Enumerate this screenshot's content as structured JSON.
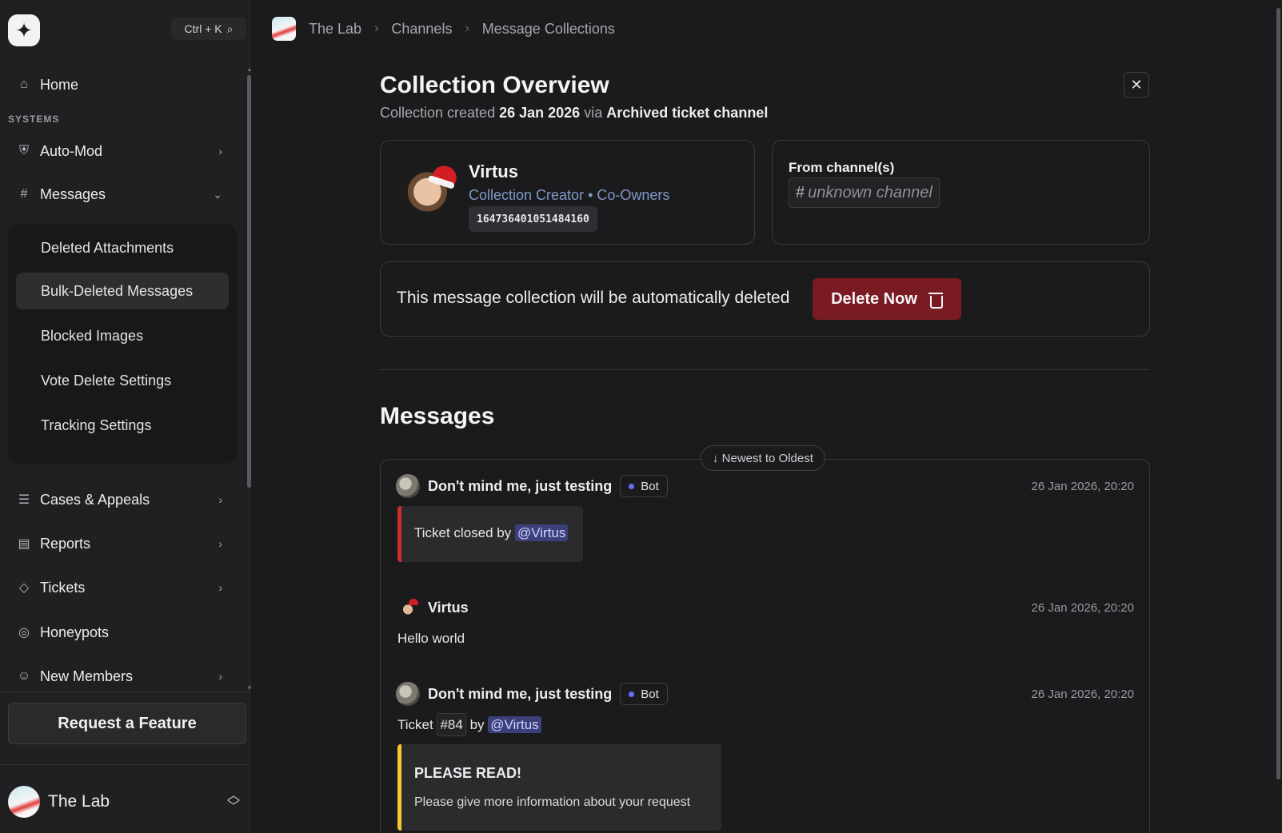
{
  "sidebar": {
    "search_shortcut": "Ctrl + K",
    "home_label": "Home",
    "section_label": "SYSTEMS",
    "items": [
      {
        "label": "Auto-Mod"
      },
      {
        "label": "Messages"
      },
      {
        "label": "Cases & Appeals"
      },
      {
        "label": "Reports"
      },
      {
        "label": "Tickets"
      },
      {
        "label": "Honeypots"
      },
      {
        "label": "New Members"
      }
    ],
    "submenu": [
      {
        "label": "Deleted Attachments"
      },
      {
        "label": "Bulk-Deleted Messages"
      },
      {
        "label": "Blocked Images"
      },
      {
        "label": "Vote Delete Settings"
      },
      {
        "label": "Tracking Settings"
      }
    ],
    "feature_button": "Request a Feature",
    "server_name": "The Lab"
  },
  "breadcrumb": [
    "The Lab",
    "Channels",
    "Message Collections"
  ],
  "overview": {
    "title": "Collection Overview",
    "created_prefix": "Collection created",
    "created_date": "26 Jan 2026",
    "via_word": "via",
    "via_source": "Archived ticket channel",
    "close_label": "✕"
  },
  "creator": {
    "name": "Virtus",
    "role": "Collection Creator • Co-Owners",
    "id": "164736401051484160"
  },
  "channels": {
    "label": "From channel(s)",
    "hash": "#",
    "value": "unknown channel"
  },
  "deletion": {
    "text": "This message collection will be automatically deleted",
    "button": "Delete Now"
  },
  "messages": {
    "title": "Messages",
    "sort_label": "↓ Newest to Oldest",
    "bot_tag": "Bot",
    "items": [
      {
        "author": "Don't mind me, just testing",
        "time": "26 Jan 2026, 20:20",
        "embed_text": "Ticket closed by",
        "mention": "@Virtus"
      },
      {
        "author": "Virtus",
        "time": "26 Jan 2026, 20:20",
        "text": "Hello world"
      },
      {
        "author": "Don't mind me, just testing",
        "time": "26 Jan 2026, 20:20",
        "text_prefix": "Ticket",
        "ticket_ref": "#84",
        "text_by": "by",
        "mention": "@Virtus",
        "embed_title": "PLEASE READ!",
        "embed_body": "Please give more information about your request"
      }
    ]
  },
  "colors": {
    "background": "#1b1b1d",
    "sidebar": "#202022",
    "danger": "#7a1a22",
    "accent_blue": "#7f98c8",
    "bot_dot": "#6d6bf0",
    "embed_red": "#d12d2d",
    "embed_yellow": "#f2c82e"
  },
  "icons": [
    "logo-icon",
    "search-icon",
    "home-icon",
    "automod-icon",
    "hash-icon",
    "chevron-right-icon",
    "chevron-down-icon",
    "cases-icon",
    "reports-icon",
    "tag-icon",
    "honeypot-icon",
    "new-members-icon",
    "updown-icon",
    "close-icon",
    "trash-icon"
  ]
}
